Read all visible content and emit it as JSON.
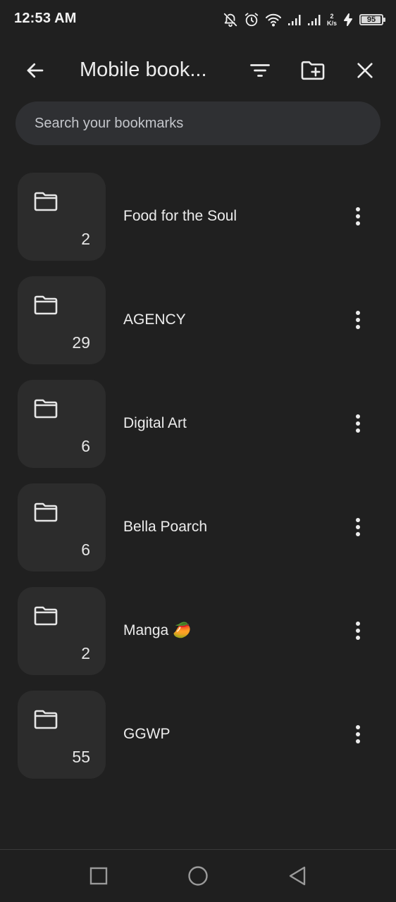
{
  "status_bar": {
    "time": "12:53 AM",
    "net_speed_value": "2",
    "net_speed_unit": "K/s",
    "battery_level": "95",
    "battery_fraction": 0.95,
    "icons": [
      "bell-off-icon",
      "alarm-icon",
      "wifi-icon",
      "signal-icon",
      "signal-icon",
      "charging-icon"
    ]
  },
  "toolbar": {
    "title": "Mobile book...",
    "icons": [
      "arrow-back-icon",
      "sort-icon",
      "new-folder-icon",
      "close-icon"
    ]
  },
  "search": {
    "placeholder": "Search your bookmarks"
  },
  "bookmarks": [
    {
      "title": "Food for the Soul",
      "count": "2"
    },
    {
      "title": "AGENCY",
      "count": "29"
    },
    {
      "title": "Digital Art",
      "count": "6"
    },
    {
      "title": "Bella Poarch",
      "count": "6"
    },
    {
      "title": "Manga 🥭",
      "count": "2"
    },
    {
      "title": "GGWP",
      "count": "55"
    }
  ],
  "nav_bar": {
    "icons": [
      "recents-icon",
      "home-icon",
      "back-icon"
    ]
  },
  "colors": {
    "background": "#202020",
    "tile": "#2c2c2c",
    "search_background": "#2f3033",
    "text": "#e8e8e8"
  }
}
